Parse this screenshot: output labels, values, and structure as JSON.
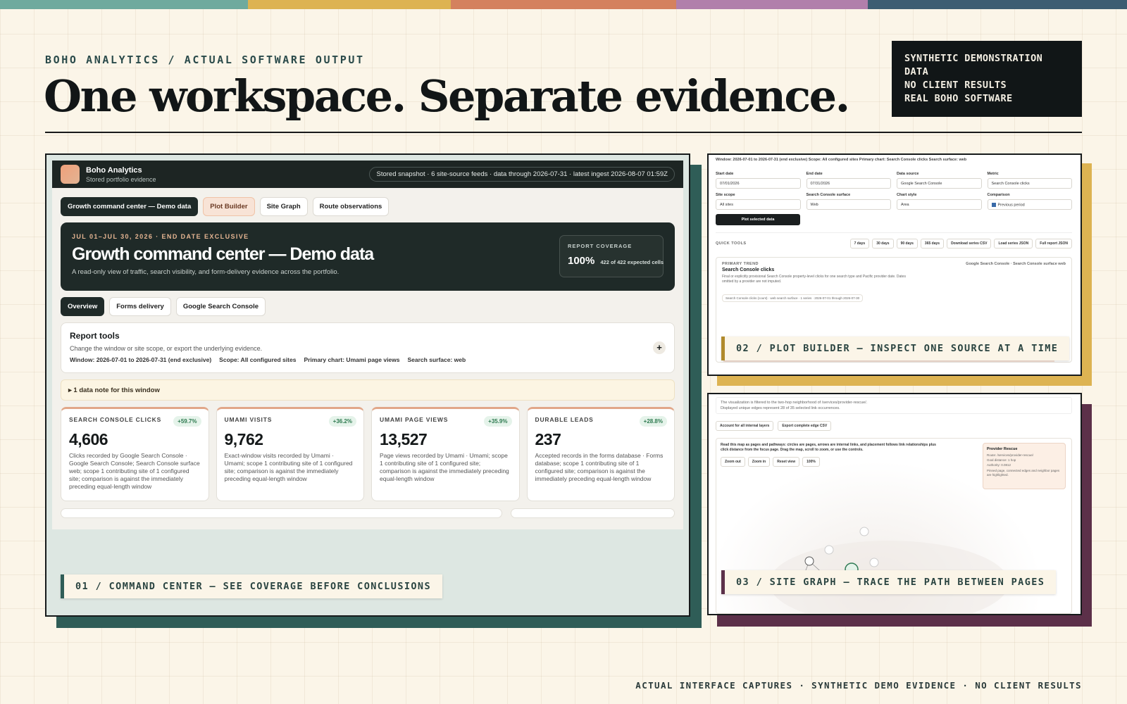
{
  "colors": {
    "stripe": [
      "#6faa9e",
      "#ddb352",
      "#d4815e",
      "#b17fab",
      "#3d5d72"
    ],
    "panel1": "#2f5d57",
    "panel2": "#ddb352",
    "panel3": "#5c3049"
  },
  "header": {
    "kicker": "BOHO ANALYTICS / ACTUAL SOFTWARE OUTPUT",
    "title": "One workspace. Separate evidence."
  },
  "disclaimer": [
    "SYNTHETIC DEMONSTRATION",
    "DATA",
    "NO CLIENT RESULTS",
    "REAL BOHO SOFTWARE"
  ],
  "footer": "ACTUAL INTERFACE CAPTURES · SYNTHETIC DEMO EVIDENCE · NO CLIENT RESULTS",
  "panel1": {
    "caption": "01 / COMMAND CENTER — SEE COVERAGE BEFORE CONCLUSIONS",
    "app_name": "Boho Analytics",
    "app_sub": "Stored portfolio evidence",
    "snapshot": "Stored snapshot · 6 site-source feeds · data through 2026-07-31 · latest ingest 2026-08-07 01:59Z",
    "tabs": [
      "Growth command center — Demo data",
      "Plot Builder",
      "Site Graph",
      "Route observations"
    ],
    "hero": {
      "date": "JUL 01–JUL 30, 2026 · END DATE EXCLUSIVE",
      "title": "Growth command center — Demo data",
      "desc": "A read-only view of traffic, search visibility, and form-delivery evidence across the portfolio.",
      "cov_label": "REPORT COVERAGE",
      "cov_val": "100%",
      "cov_sub": "422 of 422 expected cells"
    },
    "subtabs": [
      "Overview",
      "Forms delivery",
      "Google Search Console"
    ],
    "report_tools": {
      "title": "Report tools",
      "desc": "Change the window or site scope, or export the underlying evidence.",
      "meta": [
        "Window: 2026-07-01 to 2026-07-31 (end exclusive)",
        "Scope: All configured sites",
        "Primary chart: Umami page views",
        "Search surface: web"
      ],
      "plus": "+"
    },
    "note": "▸ 1 data note for this window",
    "kpis": [
      {
        "label": "SEARCH CONSOLE CLICKS",
        "delta": "+59.7%",
        "value": "4,606",
        "desc": "Clicks recorded by Google Search Console · Google Search Console; Search Console surface web; scope 1 contributing site of 1 configured site; comparison is against the immediately preceding equal-length window"
      },
      {
        "label": "UMAMI VISITS",
        "delta": "+36.2%",
        "value": "9,762",
        "desc": "Exact-window visits recorded by Umami · Umami; scope 1 contributing site of 1 configured site; comparison is against the immediately preceding equal-length window"
      },
      {
        "label": "UMAMI PAGE VIEWS",
        "delta": "+35.9%",
        "value": "13,527",
        "desc": "Page views recorded by Umami · Umami; scope 1 contributing site of 1 configured site; comparison is against the immediately preceding equal-length window"
      },
      {
        "label": "DURABLE LEADS",
        "delta": "+28.8%",
        "value": "237",
        "desc": "Accepted records in the forms database · Forms database; scope 1 contributing site of 1 configured site; comparison is against the immediately preceding equal-length window"
      }
    ]
  },
  "panel2": {
    "caption": "02 / PLOT BUILDER — INSPECT ONE SOURCE AT A TIME",
    "window_line": "Window: 2026-07-01 to 2026-07-31 (end exclusive)   Scope: All configured sites   Primary chart: Search Console clicks   Search surface: web",
    "fields": [
      {
        "label": "Start date",
        "value": "07/01/2026"
      },
      {
        "label": "End date",
        "value": "07/31/2026"
      },
      {
        "label": "Data source",
        "value": "Google Search Console"
      },
      {
        "label": "Metric",
        "value": "Search Console clicks"
      },
      {
        "label": "Site scope",
        "value": "All sites"
      },
      {
        "label": "Search Console surface",
        "value": "Web"
      },
      {
        "label": "Chart style",
        "value": "Area"
      },
      {
        "label": "Comparison",
        "value": "Previous period"
      }
    ],
    "plot_button": "Plot selected data",
    "quick_tools": "QUICK TOOLS",
    "quick": [
      "7 days",
      "30 days",
      "90 days",
      "365 days",
      "Download series CSV",
      "Load series JSON",
      "Full report JSON"
    ],
    "trend_kicker": "PRIMARY TREND",
    "trend_title": "Search Console clicks",
    "trend_tag": "Google Search Console · Search Console surface web",
    "trend_desc": "Final or explicitly provisional Search Console property-level clicks for one search type and Pacific provider date. Dates omitted by a provider are not imputed.",
    "chart_legend": "Search Console clicks (count) · web search surface · 1 series · 2026-07-01 through 2026-07-30"
  },
  "panel3": {
    "caption": "03 / SITE GRAPH — TRACE THE PATH BETWEEN PAGES",
    "bullets": [
      "The visualization is filtered to the two-hop neighborhood of /services/provider-rescue/.",
      "Displayed unique edges represent 28 of 35 selected link occurrences."
    ],
    "actions": [
      "Account for all internal layers",
      "Export complete edge CSV"
    ],
    "help": "Read this map as pages and pathways: circles are pages, arrows are internal links, and placement follows link relationships plus click distance from the focus page. Drag the map, scroll to zoom, or use the controls.",
    "controls": [
      "Zoom out",
      "Zoom in",
      "Reset view",
      "100%"
    ],
    "detail": {
      "title": "Provider Rescue",
      "route": "Route: /services/provider-rescue/",
      "goal": "Goal distance: 1 hop",
      "authority": "Authority: 0.0812",
      "desc": "Pinned page, connected edges and neighbor pages are highlighted."
    }
  }
}
